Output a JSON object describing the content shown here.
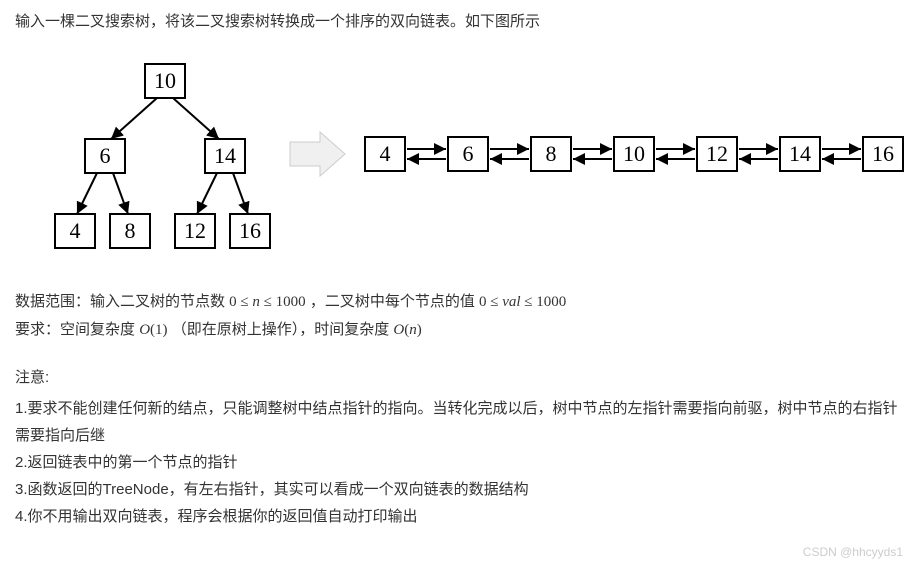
{
  "intro": "输入一棵二叉搜索树，将该二叉搜索树转换成一个排序的双向链表。如下图所示",
  "tree_nodes": {
    "root": "10",
    "l": "6",
    "r": "14",
    "ll": "4",
    "lr": "8",
    "rl": "12",
    "rr": "16"
  },
  "list_nodes": [
    "4",
    "6",
    "8",
    "10",
    "12",
    "14",
    "16"
  ],
  "data_range_prefix": "数据范围：输入二叉树的节点数 ",
  "data_range_n": "0 ≤ n ≤ 1000",
  "data_range_mid": "，二叉树中每个节点的值 ",
  "data_range_val": "0 ≤ val ≤ 1000",
  "requirement_prefix": "要求：空间复杂度",
  "req_space": "O(1)",
  "req_space_note": "（即在原树上操作），时间复杂度 ",
  "req_time": "O(n)",
  "notes_title": "注意:",
  "notes": [
    "1.要求不能创建任何新的结点，只能调整树中结点指针的指向。当转化完成以后，树中节点的左指针需要指向前驱，树中节点的右指针需要指向后继",
    "2.返回链表中的第一个节点的指针",
    "3.函数返回的TreeNode，有左右指针，其实可以看成一个双向链表的数据结构",
    "4.你不用输出双向链表，程序会根据你的返回值自动打印输出"
  ],
  "watermark": "CSDN @hhcyyds1"
}
